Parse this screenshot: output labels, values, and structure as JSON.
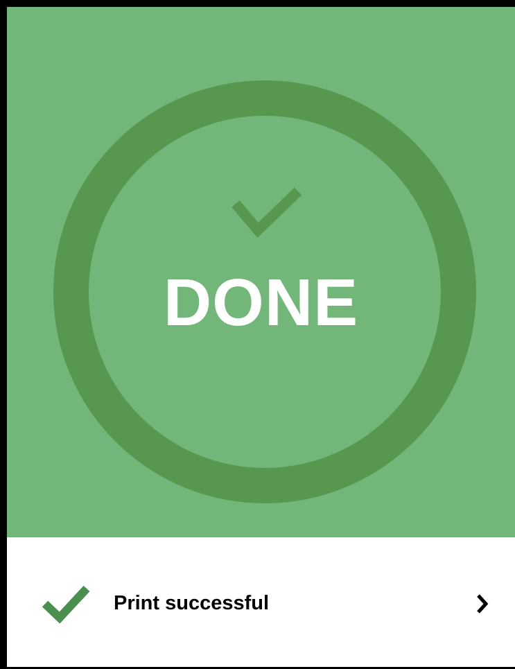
{
  "status_panel": {
    "status_text": "DONE",
    "icon": "checkmark-icon",
    "background_color": "#72b779",
    "ring_color": "#57974f"
  },
  "result_row": {
    "label": "Print successful",
    "leading_icon": "checkmark-icon",
    "trailing_icon": "chevron-right-icon",
    "check_color": "#4a8f4d"
  }
}
